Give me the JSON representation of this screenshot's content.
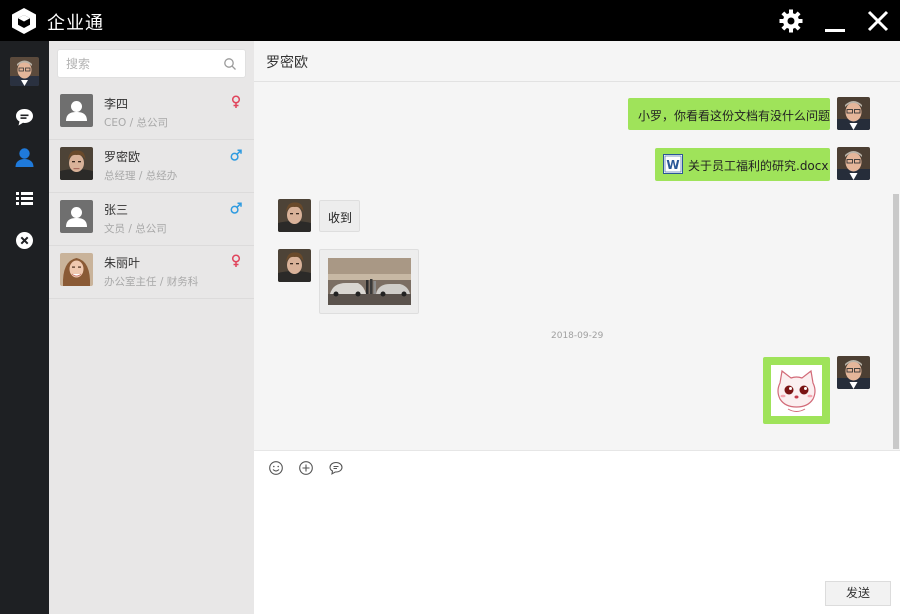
{
  "window": {
    "title": "企业通",
    "icons": [
      "cube-logo-icon",
      "gear-icon",
      "minimize-icon",
      "close-icon"
    ]
  },
  "nav": {
    "items": [
      {
        "name": "messages",
        "icon": "chat-bubble-icon"
      },
      {
        "name": "contacts",
        "icon": "person-icon",
        "active": true
      },
      {
        "name": "list",
        "icon": "list-icon"
      },
      {
        "name": "exit",
        "icon": "close-circle-icon"
      }
    ],
    "active_color": "#1f7adb"
  },
  "search": {
    "placeholder": "搜索"
  },
  "contacts": [
    {
      "name": "李四",
      "title": "CEO / 总公司",
      "gender": "female",
      "avatar": "default"
    },
    {
      "name": "罗密欧",
      "title": "总经理 / 总经办",
      "gender": "male",
      "avatar": "photo-romeo",
      "active": true
    },
    {
      "name": "张三",
      "title": "文员 / 总公司",
      "gender": "male",
      "avatar": "default"
    },
    {
      "name": "朱丽叶",
      "title": "办公室主任 / 财务科",
      "gender": "female",
      "avatar": "photo-juliet"
    }
  ],
  "chat": {
    "title": "罗密欧",
    "messages": [
      {
        "direction": "out",
        "type": "text",
        "text": "小罗，你看看这份文档有没什么问题"
      },
      {
        "direction": "out",
        "type": "file",
        "text": "关于员工福利的研究.docx",
        "icon": "word-doc-icon"
      },
      {
        "direction": "in",
        "type": "text",
        "text": "收到"
      },
      {
        "direction": "in",
        "type": "image",
        "description": "car-photo"
      },
      {
        "direction": "out",
        "type": "sticker",
        "description": "cat-sticker"
      }
    ],
    "timestamp": "2018-09-29"
  },
  "composer": {
    "tools": [
      "emoji-icon",
      "add-icon",
      "chat-icon"
    ],
    "send_label": "发送"
  },
  "colors": {
    "titlebar": "#000000",
    "nav_bg": "#1e2023",
    "bubble_out": "#9fe35a",
    "gender_female": "#e0455c",
    "gender_male": "#2f9be0"
  }
}
